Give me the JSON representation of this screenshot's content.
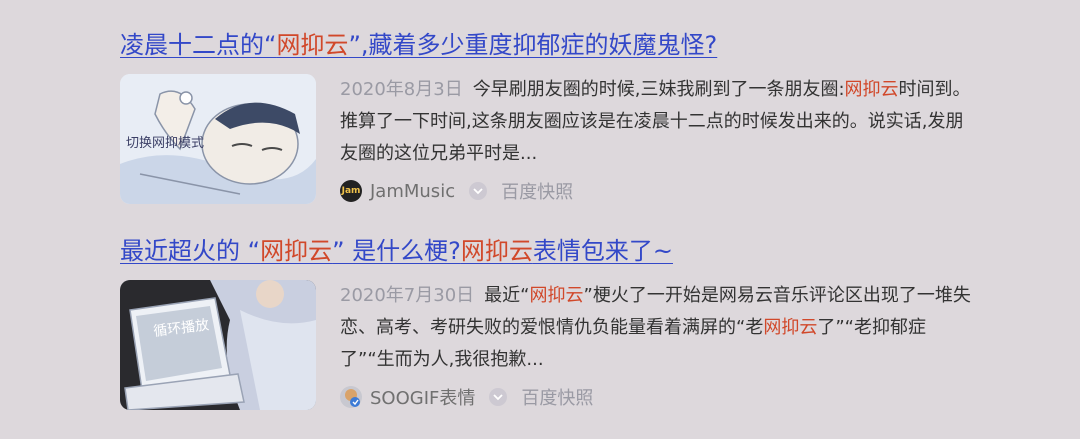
{
  "results": [
    {
      "title_part1": "凌晨十二点的“",
      "title_hl": "网抑云",
      "title_part2": "”,藏着多少重度抑郁症的妖魔鬼怪?",
      "thumb_caption": "切换网抑模式",
      "date": "2020年8月3日",
      "abstract_part1": "今早刷朋友圈的时候,三妹我刷到了一条朋友圈:",
      "abstract_hl": "网抑云",
      "abstract_part2": "时间到。 推算了一下时间,这条朋友圈应该是在凌晨十二点的时候发出来的。说实话,发朋友圈的这位兄弟平时是...",
      "logo_text": "Jam",
      "site": "JamMusic",
      "snapshot": "百度快照"
    },
    {
      "title_part1": "最近超火的 “",
      "title_hl": "网抑云",
      "title_part2": "” 是什么梗?",
      "title_hl2": "网抑云",
      "title_part3": "表情包来了~",
      "thumb_caption": "循环播放",
      "date": "2020年7月30日",
      "abstract_part1": "最近“",
      "abstract_hl": "网抑云",
      "abstract_part2": "”梗火了一开始是网易云音乐评论区出现了一堆失恋、高考、考研失败的爱恨情仇负能量看着满屏的“老",
      "abstract_hl2": "网抑云",
      "abstract_part3": "了”“老抑郁症了”“生而为人,我很抱歉...",
      "site": "SOOGIF表情",
      "snapshot": "百度快照"
    }
  ],
  "colors": {
    "background": "#ddd8dc",
    "link": "#3348c8",
    "highlight": "#d1482a",
    "date": "#9a9aa4"
  }
}
